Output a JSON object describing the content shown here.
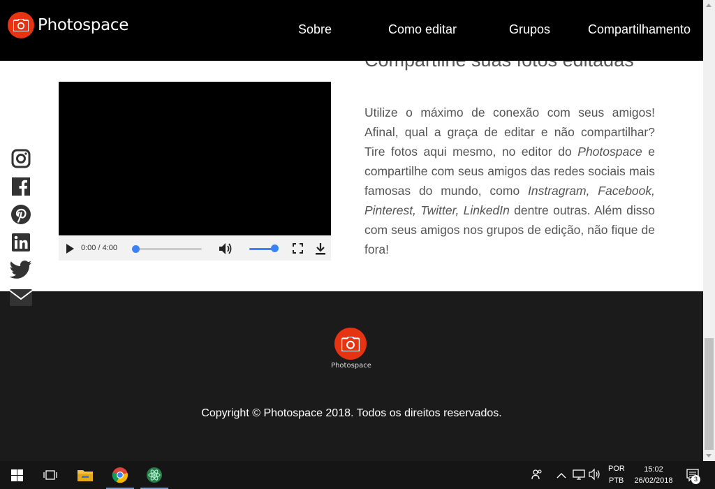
{
  "header": {
    "logo_text": "Photospace",
    "nav": [
      "Sobre",
      "Como editar",
      "Grupos",
      "Compartilhamento"
    ]
  },
  "main": {
    "section_title": "Compartilhe suas fotos editadas",
    "video": {
      "time": "0:00 / 4:00",
      "progress": 0,
      "volume": 1
    },
    "paragraph": {
      "p1": "Utilize o máximo de conexão com seus amigos! Afinal, qual a graça de editar e não compartilhar? Tire fotos aqui mesmo, no editor do ",
      "brand": "Photospace",
      "p2": " e compartilhe com seus amigos das redes sociais mais famosas do mundo, como ",
      "networks": "Instragram, Facebook, Pinterest, Twitter, LinkedIn",
      "p3": " dentre outras. Além disso com seus amigos nos grupos de edição, não fique de fora!"
    }
  },
  "social": [
    "instagram-icon",
    "facebook-icon",
    "pinterest-icon",
    "linkedin-icon",
    "twitter-icon",
    "mail-icon"
  ],
  "footer": {
    "logo_text": "Photospace",
    "copyright": "Copyright © Photospace 2018. Todos os direitos reservados."
  },
  "taskbar": {
    "lang_top": "POR",
    "lang_bottom": "PTB",
    "time": "15:02",
    "date": "26/02/2018",
    "notifications": "3"
  },
  "colors": {
    "brand": "#e63312",
    "header_bg": "#000000",
    "footer_bg": "#1b1b1b",
    "accent": "#3b82f6"
  }
}
